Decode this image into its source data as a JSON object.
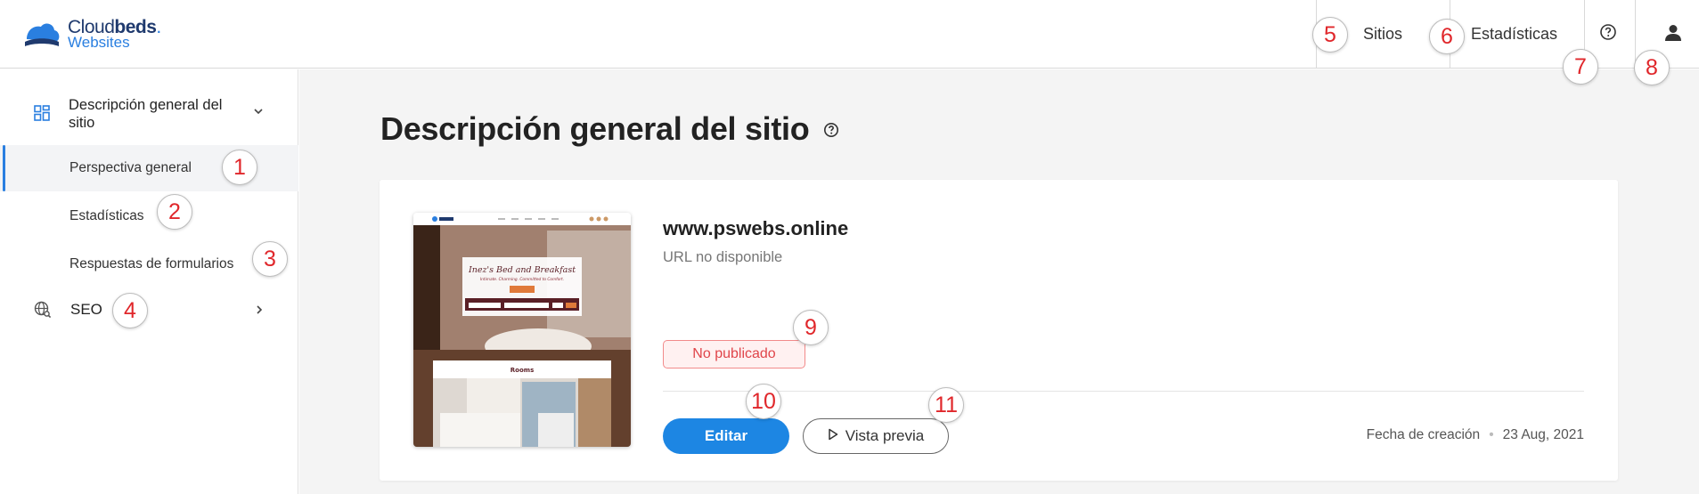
{
  "header": {
    "logo_line1_a": "Cloud",
    "logo_line1_b": "beds",
    "logo_line2": "Websites",
    "nav": {
      "sites": "Sitios",
      "stats": "Estadísticas"
    },
    "icons": [
      "help-icon",
      "user-icon"
    ]
  },
  "sidebar": {
    "group_label": "Descripción general del sitio",
    "items": [
      {
        "label": "Perspectiva general"
      },
      {
        "label": "Estadísticas"
      },
      {
        "label": "Respuestas de formularios"
      }
    ],
    "seo_label": "SEO"
  },
  "main": {
    "title": "Descripción general del sitio",
    "site": {
      "domain": "www.pswebs.online",
      "url_status": "URL no disponible",
      "status": "No publicado",
      "edit_label": "Editar",
      "preview_label": "Vista previa",
      "created_label": "Fecha de creación",
      "created_date": "23 Aug, 2021",
      "thumbnail": {
        "hero_title": "Inez's Bed and Breakfast",
        "hero_subtitle": "Intimate. Charming. Committed to Comfort.",
        "rooms_heading": "Rooms"
      }
    }
  },
  "badges": [
    "1",
    "2",
    "3",
    "4",
    "5",
    "6",
    "7",
    "8",
    "9",
    "10",
    "11"
  ],
  "colors": {
    "accent": "#1d86e3",
    "status_red": "#e0454a",
    "badge_red": "#e0272b"
  }
}
